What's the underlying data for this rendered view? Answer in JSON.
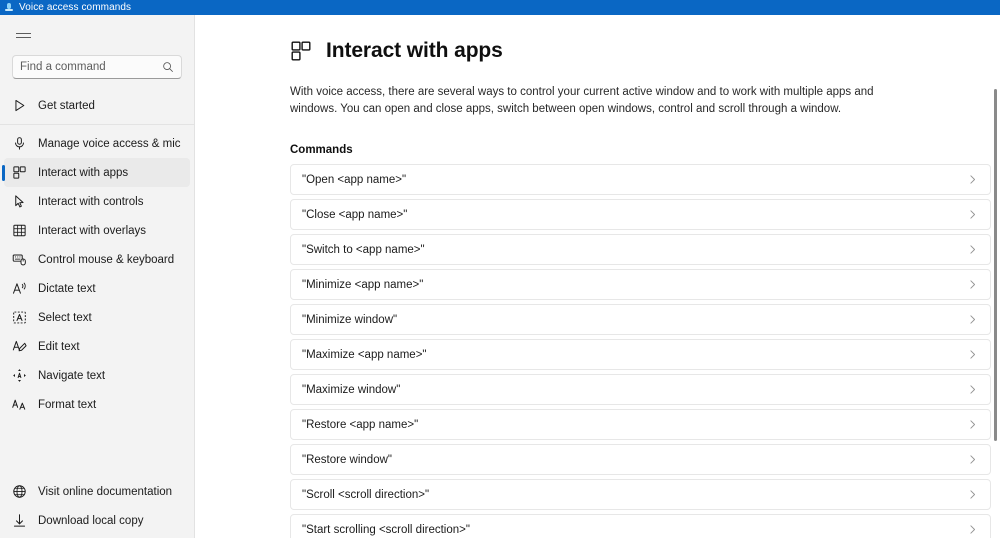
{
  "window": {
    "title": "Voice access commands",
    "icon": "voice-access-icon",
    "titlebar_color": "#0a67c4"
  },
  "sidebar": {
    "menu_button": "hamburger-menu",
    "search": {
      "placeholder": "Find a command",
      "value": "",
      "icon": "search-icon"
    },
    "items": [
      {
        "label": "Get started",
        "icon": "play-icon",
        "selected": false
      },
      {
        "label": "Manage voice access & mic",
        "icon": "microphone-icon",
        "selected": false
      },
      {
        "label": "Interact with apps",
        "icon": "apps-grid-icon",
        "selected": true
      },
      {
        "label": "Interact with controls",
        "icon": "cursor-arrow-icon",
        "selected": false
      },
      {
        "label": "Interact with overlays",
        "icon": "grid-overlay-icon",
        "selected": false
      },
      {
        "label": "Control mouse & keyboard",
        "icon": "mouse-keyboard-icon",
        "selected": false
      },
      {
        "label": "Dictate text",
        "icon": "dictate-icon",
        "selected": false
      },
      {
        "label": "Select text",
        "icon": "select-text-icon",
        "selected": false
      },
      {
        "label": "Edit text",
        "icon": "edit-pencil-icon",
        "selected": false
      },
      {
        "label": "Navigate text",
        "icon": "navigate-arrows-icon",
        "selected": false
      },
      {
        "label": "Format text",
        "icon": "format-text-icon",
        "selected": false
      }
    ],
    "bottom_items": [
      {
        "label": "Visit online documentation",
        "icon": "globe-icon"
      },
      {
        "label": "Download local copy",
        "icon": "download-arrow-icon"
      }
    ]
  },
  "main": {
    "title": "Interact with apps",
    "title_icon": "apps-grid-icon",
    "description": "With voice access, there are several ways to control your current active window and to work with multiple apps and windows. You can open and close apps, switch between open windows, control and scroll through a window.",
    "section_label": "Commands",
    "commands": [
      {
        "text": "\"Open <app name>\"",
        "chevron": "chevron-right-icon"
      },
      {
        "text": "\"Close <app name>\"",
        "chevron": "chevron-right-icon"
      },
      {
        "text": "\"Switch to <app name>\"",
        "chevron": "chevron-right-icon"
      },
      {
        "text": "\"Minimize <app name>\"",
        "chevron": "chevron-right-icon"
      },
      {
        "text": "\"Minimize window\"",
        "chevron": "chevron-right-icon"
      },
      {
        "text": "\"Maximize <app name>\"",
        "chevron": "chevron-right-icon"
      },
      {
        "text": "\"Maximize window\"",
        "chevron": "chevron-right-icon"
      },
      {
        "text": "\"Restore <app name>\"",
        "chevron": "chevron-right-icon"
      },
      {
        "text": "\"Restore window\"",
        "chevron": "chevron-right-icon"
      },
      {
        "text": "\"Scroll <scroll direction>\"",
        "chevron": "chevron-right-icon"
      },
      {
        "text": "\"Start scrolling <scroll direction>\"",
        "chevron": "chevron-right-icon"
      }
    ]
  },
  "colors": {
    "accent": "#0a67c4",
    "sidebar_bg": "#f3f3f3",
    "selected_bg": "#eaeaea",
    "content_bg": "#ffffff",
    "row_border": "#e7e7e7"
  }
}
